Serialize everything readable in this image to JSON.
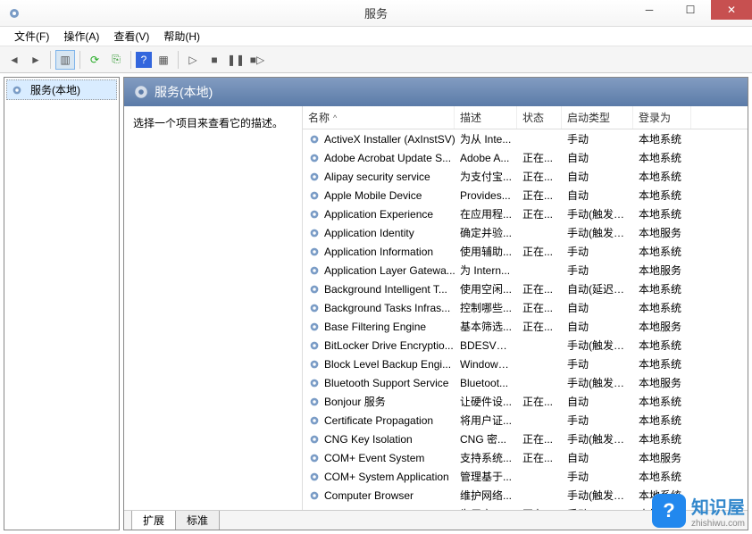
{
  "title": "服务",
  "menus": [
    "文件(F)",
    "操作(A)",
    "查看(V)",
    "帮助(H)"
  ],
  "tree_label": "服务(本地)",
  "header_label": "服务(本地)",
  "desc_hint": "选择一个项目来查看它的描述。",
  "columns": {
    "name": "名称",
    "desc": "描述",
    "status": "状态",
    "start": "启动类型",
    "logon": "登录为"
  },
  "tabs": {
    "ext": "扩展",
    "std": "标准"
  },
  "watermark": {
    "brand": "知识屋",
    "url": "zhishiwu.com"
  },
  "services": [
    {
      "name": "ActiveX Installer (AxInstSV)",
      "desc": "为从 Inte...",
      "status": "",
      "start": "手动",
      "logon": "本地系统"
    },
    {
      "name": "Adobe Acrobat Update S...",
      "desc": "Adobe A...",
      "status": "正在...",
      "start": "自动",
      "logon": "本地系统"
    },
    {
      "name": "Alipay security service",
      "desc": "为支付宝...",
      "status": "正在...",
      "start": "自动",
      "logon": "本地系统"
    },
    {
      "name": "Apple Mobile Device",
      "desc": "Provides...",
      "status": "正在...",
      "start": "自动",
      "logon": "本地系统"
    },
    {
      "name": "Application Experience",
      "desc": "在应用程...",
      "status": "正在...",
      "start": "手动(触发器...",
      "logon": "本地系统"
    },
    {
      "name": "Application Identity",
      "desc": "确定并验...",
      "status": "",
      "start": "手动(触发器...",
      "logon": "本地服务"
    },
    {
      "name": "Application Information",
      "desc": "使用辅助...",
      "status": "正在...",
      "start": "手动",
      "logon": "本地系统"
    },
    {
      "name": "Application Layer Gatewa...",
      "desc": "为 Intern...",
      "status": "",
      "start": "手动",
      "logon": "本地服务"
    },
    {
      "name": "Background Intelligent T...",
      "desc": "使用空闲...",
      "status": "正在...",
      "start": "自动(延迟启...",
      "logon": "本地系统"
    },
    {
      "name": "Background Tasks Infras...",
      "desc": "控制哪些...",
      "status": "正在...",
      "start": "自动",
      "logon": "本地系统"
    },
    {
      "name": "Base Filtering Engine",
      "desc": "基本筛选...",
      "status": "正在...",
      "start": "自动",
      "logon": "本地服务"
    },
    {
      "name": "BitLocker Drive Encryptio...",
      "desc": "BDESVC ...",
      "status": "",
      "start": "手动(触发器...",
      "logon": "本地系统"
    },
    {
      "name": "Block Level Backup Engi...",
      "desc": "Windows...",
      "status": "",
      "start": "手动",
      "logon": "本地系统"
    },
    {
      "name": "Bluetooth Support Service",
      "desc": "Bluetoot...",
      "status": "",
      "start": "手动(触发器...",
      "logon": "本地服务"
    },
    {
      "name": "Bonjour 服务",
      "desc": "让硬件设...",
      "status": "正在...",
      "start": "自动",
      "logon": "本地系统"
    },
    {
      "name": "Certificate Propagation",
      "desc": "将用户证...",
      "status": "",
      "start": "手动",
      "logon": "本地系统"
    },
    {
      "name": "CNG Key Isolation",
      "desc": "CNG 密...",
      "status": "正在...",
      "start": "手动(触发器...",
      "logon": "本地系统"
    },
    {
      "name": "COM+ Event System",
      "desc": "支持系统...",
      "status": "正在...",
      "start": "自动",
      "logon": "本地服务"
    },
    {
      "name": "COM+ System Application",
      "desc": "管理基于...",
      "status": "",
      "start": "手动",
      "logon": "本地系统"
    },
    {
      "name": "Computer Browser",
      "desc": "维护网络...",
      "status": "",
      "start": "手动(触发器...",
      "logon": "本地系统"
    },
    {
      "name": "Credential Manager",
      "desc": "为用户、...",
      "status": "正在...",
      "start": "手动",
      "logon": "本地系统"
    }
  ]
}
